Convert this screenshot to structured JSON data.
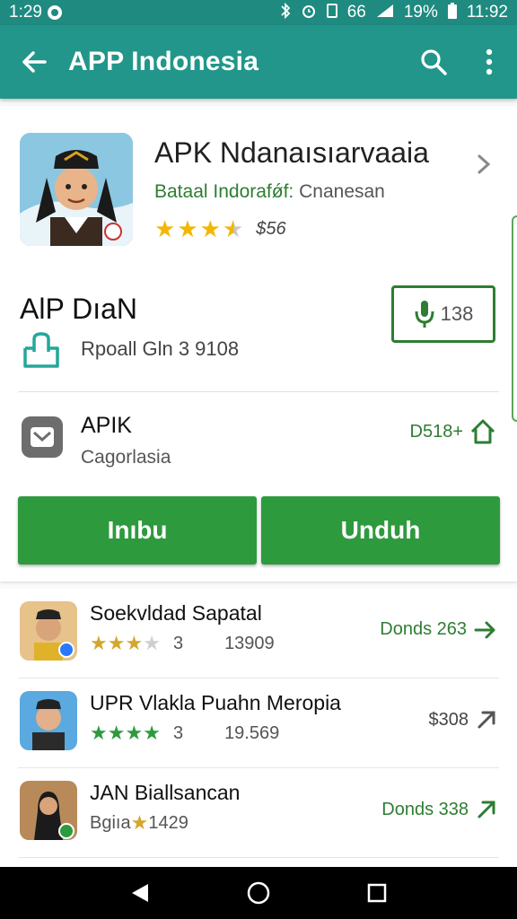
{
  "status_bar": {
    "time_left": "1:29",
    "network": "66",
    "battery": "19%",
    "time_right": "11:92"
  },
  "app_bar": {
    "title": "APP Indonesia",
    "back_icon": "arrow-left-icon",
    "search_icon": "search-icon",
    "menu_icon": "more-vert-icon",
    "color": "#22968a"
  },
  "app": {
    "name": "APK Ndanaısıarvaaia",
    "developer_green": "Bataal Indorafǿf:",
    "developer_grey": "Cnanesan",
    "rating_value": "$56",
    "stars": 3.5
  },
  "section": {
    "title": "AlP  DıaN",
    "package_text": "Rpoall Gln 3 9108",
    "count_label": "138"
  },
  "apk": {
    "title": "APIK",
    "subtitle": "Cagorlasia",
    "code": "D518+"
  },
  "buttons": {
    "left_label": "Inıbu",
    "right_label": "Unduh",
    "color": "#2e9a3e"
  },
  "list": [
    {
      "title": "Soekvldad Sapatal",
      "stars": 3.5,
      "star_color": "gold",
      "rating": "3",
      "count": "13909",
      "action": "Donds 263",
      "action_color": "green"
    },
    {
      "title": "UPR Vlakla Puahn Meropia",
      "stars": 4,
      "star_color": "green",
      "rating": "3",
      "count": "19.569",
      "action": "$308",
      "action_color": "grey"
    },
    {
      "title": "JAN Biallsancan",
      "prefix": "Bgiıa",
      "rating": "1429",
      "action": "Donds 338",
      "action_color": "green"
    }
  ],
  "accent_green": "#2e7d32"
}
